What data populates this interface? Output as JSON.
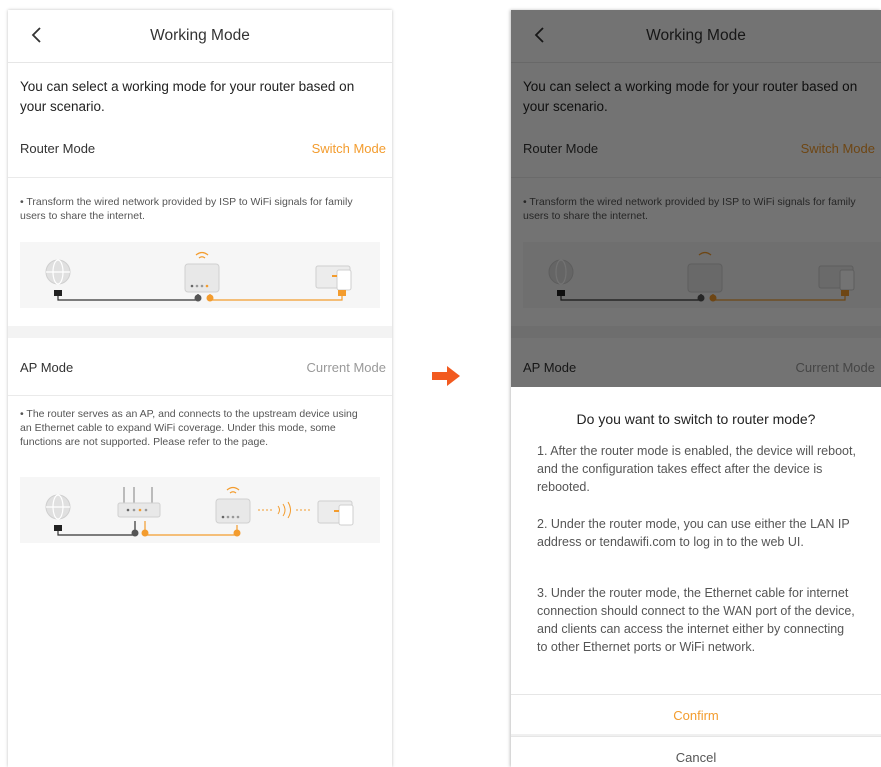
{
  "screen": {
    "title": "Working Mode",
    "intro": "You can select a working mode for your router based on your scenario.",
    "router_mode": {
      "label": "Router Mode",
      "action": "Switch Mode",
      "description": "• Transform the wired network provided by ISP to WiFi signals for family users to share the internet."
    },
    "ap_mode": {
      "label": "AP Mode",
      "status": "Current Mode",
      "description": "• The router serves as an AP, and connects to the upstream device using an Ethernet cable to expand WiFi coverage. Under this mode, some functions are not supported. Please refer to the page."
    }
  },
  "dialog": {
    "title": "Do you want to switch to router mode?",
    "paragraphs": [
      "1. After the router mode is enabled, the device will reboot, and the configuration takes effect after the device is rebooted.",
      "2. Under the router mode, you can use either the LAN IP address or tendawifi.com to log in to the web UI.",
      "3. Under the router mode, the Ethernet cable for internet connection should connect to the WAN port of the device, and clients can access the internet either by connecting to other Ethernet ports or WiFi network."
    ],
    "confirm": "Confirm",
    "cancel": "Cancel"
  },
  "icons": {
    "back": "chevron-left-icon",
    "arrow": "arrow-right-icon",
    "internet": "globe-icon",
    "router": "router-icon",
    "laptop": "laptop-icon",
    "wifi": "wifi-icon"
  },
  "colors": {
    "accent": "#f39c2e",
    "overlay": "#000000",
    "muted": "#999999"
  }
}
